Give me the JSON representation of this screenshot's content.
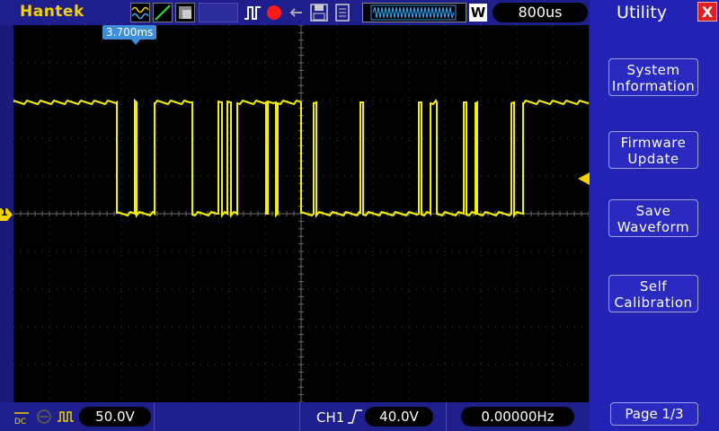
{
  "top_bar": {
    "brand": "Hantek",
    "timebase": "800us",
    "trigger_mode_letter": "W"
  },
  "scope": {
    "trigger_position_label": "3.700ms",
    "channel_marker": "1",
    "trace_color": "#f5f000"
  },
  "bottom_bar": {
    "ch1_scale": "50.0V",
    "trigger_source": "CH1",
    "trigger_level": "40.0V",
    "frequency": "0.00000Hz"
  },
  "panel": {
    "title": "Utility",
    "close_label": "X",
    "buttons": [
      {
        "line1": "System",
        "line2": "Information"
      },
      {
        "line1": "Firmware",
        "line2": "Update"
      },
      {
        "line1": "Save",
        "line2": "Waveform"
      },
      {
        "line1": "Self",
        "line2": "Calibration"
      }
    ],
    "page_label": "Page 1/3"
  }
}
